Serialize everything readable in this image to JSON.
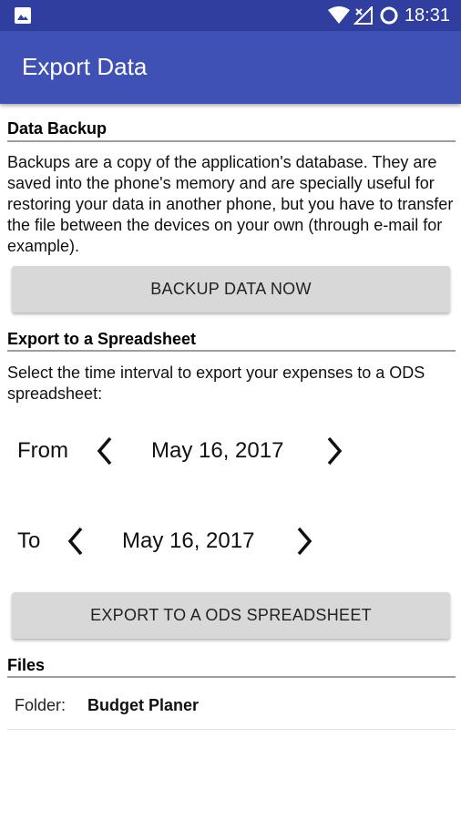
{
  "status_bar": {
    "time": "18:31",
    "icons": [
      "gallery-icon",
      "wifi-icon",
      "signal-icon",
      "sync-icon"
    ]
  },
  "app_bar": {
    "title": "Export Data"
  },
  "backup": {
    "title": "Data Backup",
    "description": "Backups are a copy of the application's database. They are saved into the phone's memory and are specially useful for restoring your data in another phone, but you have to transfer the file between the devices on your own (through e-mail for example).",
    "button_label": "BACKUP DATA NOW"
  },
  "export": {
    "title": "Export to a Spreadsheet",
    "description": "Select the time interval to export your expenses to a ODS spreadsheet:",
    "from_label": "From",
    "from_date": "May 16, 2017",
    "to_label": "To",
    "to_date": "May 16, 2017",
    "button_label": "EXPORT TO A ODS SPREADSHEET"
  },
  "files": {
    "title": "Files",
    "folder_label": "Folder:",
    "folder_value": "Budget Planer"
  },
  "colors": {
    "status_bar": "#303f9f",
    "app_bar": "#3f51b5",
    "button_bg": "#d8d8d8"
  }
}
